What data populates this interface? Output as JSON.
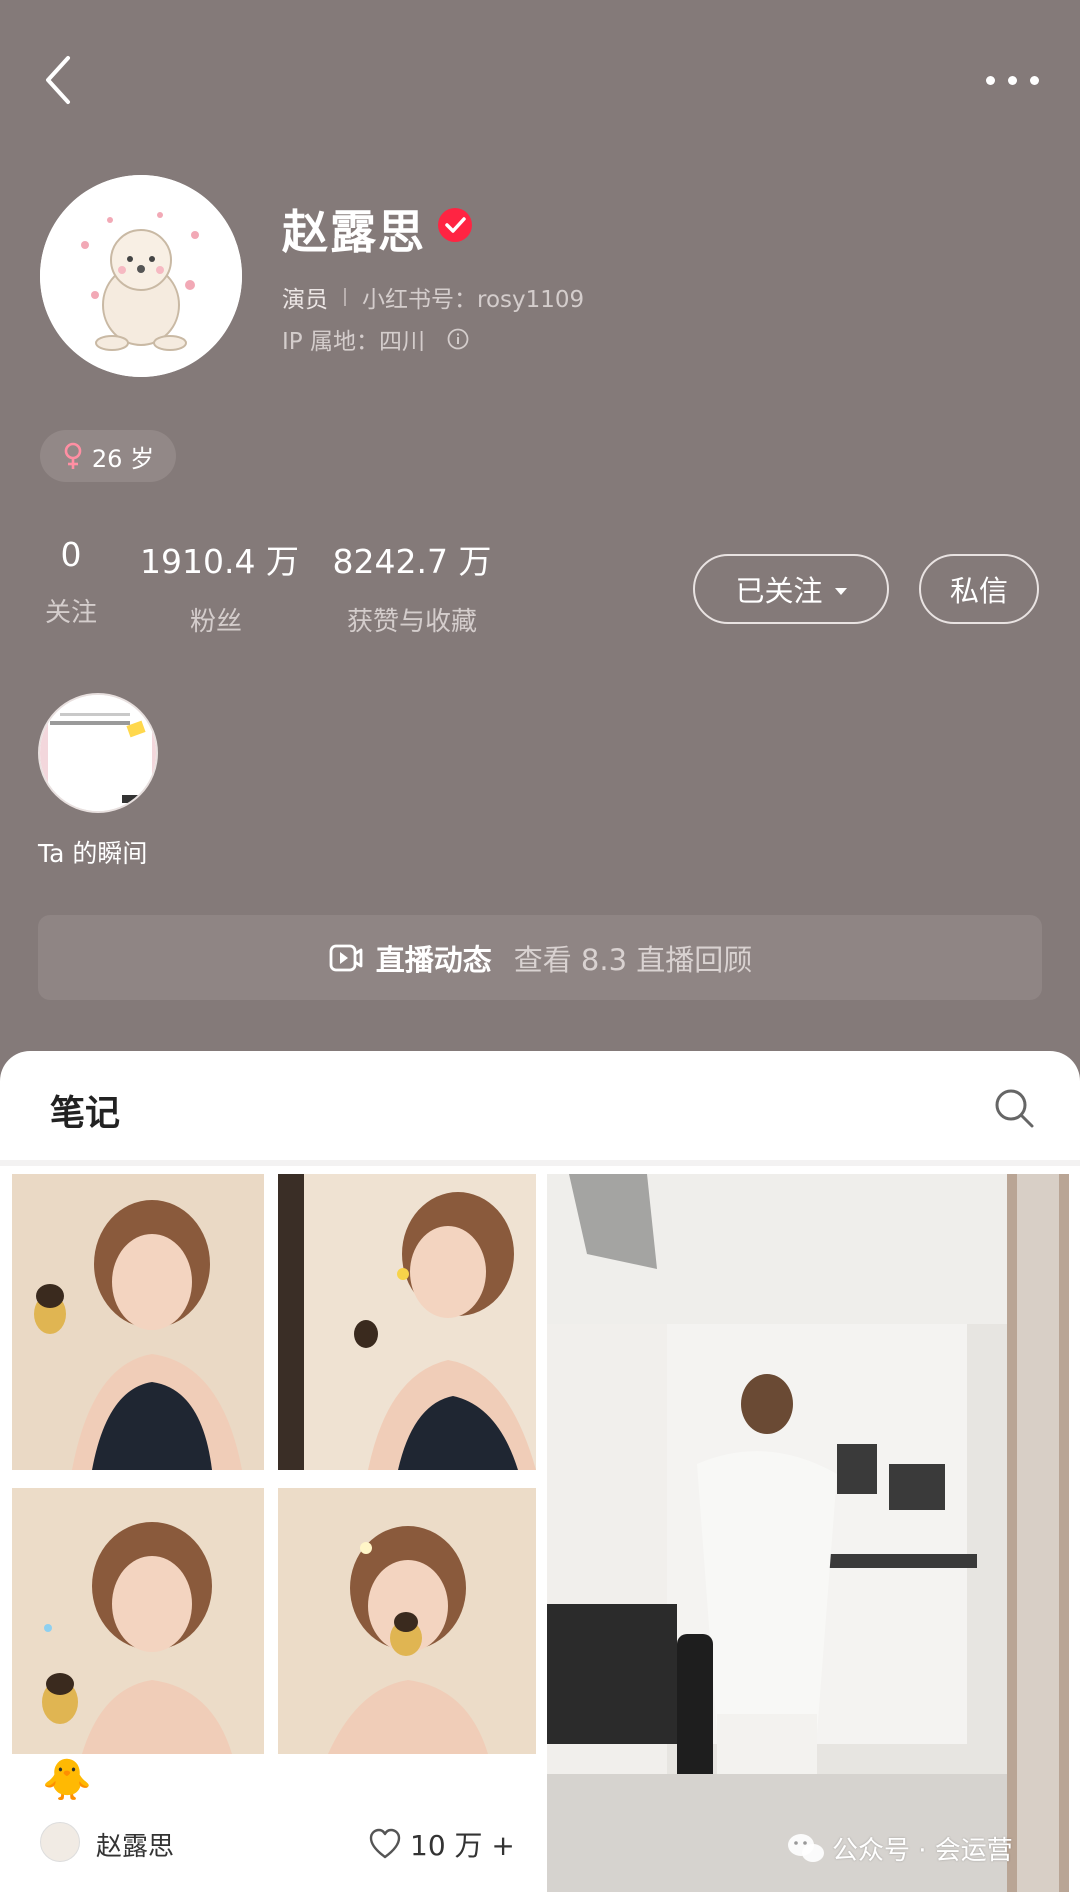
{
  "header": {
    "back_icon": "chevron-left-icon",
    "more_icon": "more-horizontal-icon"
  },
  "profile": {
    "name": "赵露思",
    "verified_icon": "verified-badge-icon",
    "occupation": "演员",
    "xhs_id_label": "小红书号：rosy1109",
    "ip_label": "IP 属地：四川",
    "age_label": "26 岁",
    "gender_icon": "female-icon",
    "colors": {
      "verified": "#ff2442",
      "gender": "#ff8fa3",
      "background": "#847a79"
    }
  },
  "stats": [
    {
      "value": "0",
      "label": "关注"
    },
    {
      "value": "1910.4 万",
      "label": "粉丝"
    },
    {
      "value": "8242.7 万",
      "label": "获赞与收藏"
    }
  ],
  "actions": {
    "follow_label": "已关注",
    "message_label": "私信"
  },
  "moments": {
    "label": "Ta 的瞬间"
  },
  "live": {
    "title": "直播动态",
    "subtitle": "查看 8.3 直播回顾"
  },
  "notes": {
    "title": "笔记",
    "search_icon": "search-icon",
    "cards": [
      {
        "title_emoji": "🐥",
        "author": "赵露思",
        "likes": "10 万 +"
      }
    ]
  },
  "watermark": "公众号 · 会运营"
}
